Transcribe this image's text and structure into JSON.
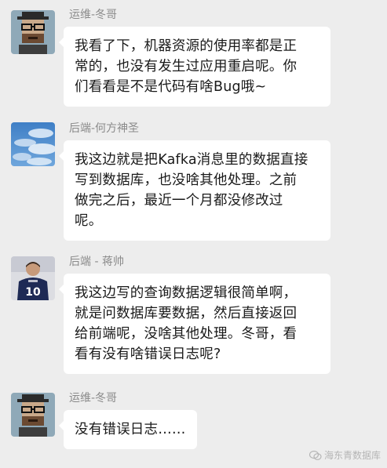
{
  "messages": [
    {
      "sender": "运维-冬哥",
      "avatar_icon": "pixel-avatar-hat-glasses",
      "lines": [
        "我看了下，机器资源的使用率都是正",
        "常的，也没有发生过应用重启呢。你",
        "们看看是不是代码有啥Bug哦~"
      ]
    },
    {
      "sender": "后端-何方神圣",
      "avatar_icon": "sky-clouds-avatar",
      "lines": [
        "我这边就是把Kafka消息里的数据直接",
        "写到数据库，也没啥其他处理。之前",
        "做完之后，最近一个月都没修改过",
        "呢。"
      ]
    },
    {
      "sender": "后端 - 蒋帅",
      "avatar_icon": "soccer-player-avatar",
      "lines": [
        "我这边写的查询数据逻辑很简单啊，",
        "就是问数据库要数据，然后直接返回",
        "给前端呢，没啥其他处理。冬哥，看",
        "看有没有啥错误日志呢?"
      ]
    },
    {
      "sender": "运维-冬哥",
      "avatar_icon": "pixel-avatar-hat-glasses",
      "lines": [
        "没有错误日志……"
      ]
    }
  ],
  "watermark": {
    "text": "海东青数据库",
    "icon": "wechat-official-account-icon"
  },
  "colors": {
    "background": "#ededed",
    "bubble": "#ffffff",
    "sender_text": "#8a8a8a"
  }
}
